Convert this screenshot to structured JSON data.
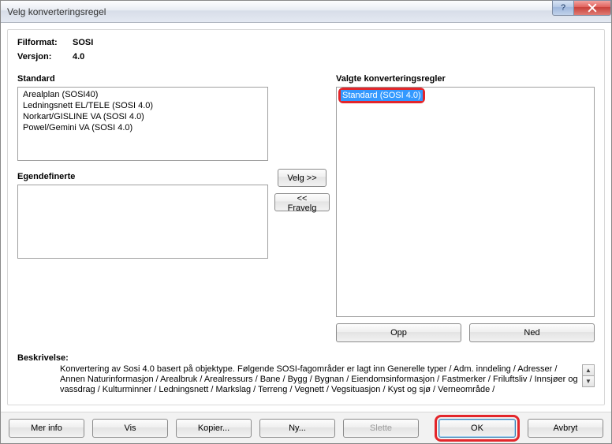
{
  "window": {
    "title": "Velg konverteringsregel",
    "help_glyph": "?",
    "close_glyph": "✕"
  },
  "meta": {
    "format_label": "Filformat:",
    "format_value": "SOSI",
    "version_label": "Versjon:",
    "version_value": "4.0"
  },
  "labels": {
    "standard": "Standard",
    "user_defined": "Egendefinerte",
    "selected_rules": "Valgte konverteringsregler",
    "description": "Beskrivelse:"
  },
  "standard_list": [
    "Arealplan (SOSI40)",
    "Ledningsnett EL/TELE (SOSI 4.0)",
    "Norkart/GISLINE VA (SOSI 4.0)",
    "Powel/Gemini VA (SOSI 4.0)"
  ],
  "user_defined_list": [],
  "selected_list": [
    "Standard (SOSI 4.0)"
  ],
  "buttons": {
    "select": "Velg >>",
    "deselect": "<< Fravelg",
    "up": "Opp",
    "down": "Ned",
    "more_info": "Mer info",
    "show": "Vis",
    "copy": "Kopier...",
    "new": "Ny...",
    "delete": "Slette",
    "ok": "OK",
    "cancel": "Avbryt"
  },
  "description_text": "Konvertering av Sosi 4.0 basert på objektype. Følgende SOSI-fagområder er lagt inn Generelle typer / Adm. inndeling / Adresser / Annen Naturinformasjon / Arealbruk / Arealressurs / Bane / Bygg / Bygnan / Eiendomsinformasjon / Fastmerker / Friluftsliv / Innsjøer og vassdrag / Kulturminner / Ledningsnett / Markslag / Terreng / Vegnett / Vegsituasjon / Kyst og sjø / Verneområde /",
  "scroll": {
    "up": "▲",
    "down": "▼"
  }
}
